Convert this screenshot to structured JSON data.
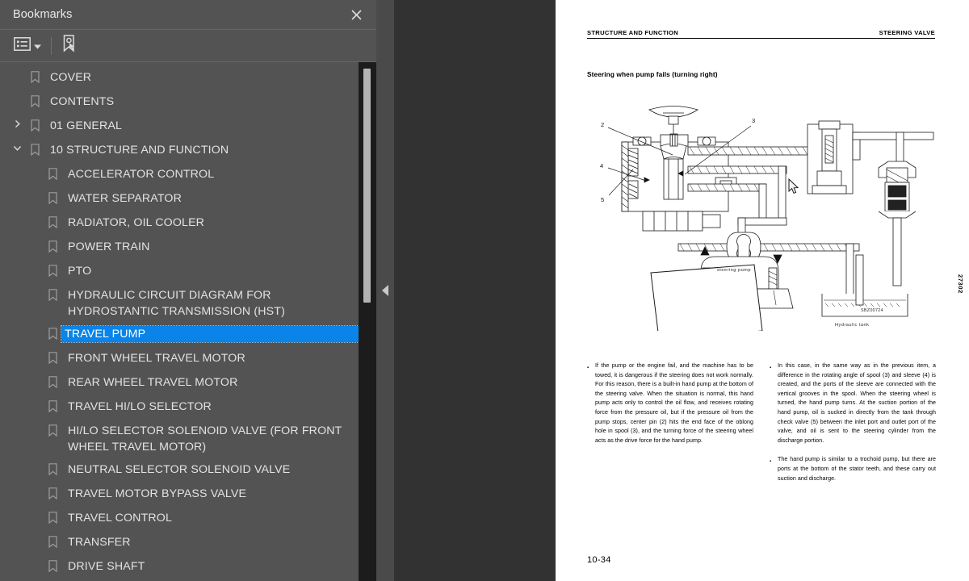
{
  "panel": {
    "title": "Bookmarks",
    "close_icon": "close-icon",
    "toolbar": {
      "options_icon": "list-options-icon",
      "chevron_icon": "chevron-down-icon",
      "new_bookmark_icon": "new-bookmark-icon"
    },
    "selected_color": "#0a84e8",
    "items": [
      {
        "label": "COVER",
        "level": 0,
        "twisty": "",
        "selected": false
      },
      {
        "label": "CONTENTS",
        "level": 0,
        "twisty": "",
        "selected": false
      },
      {
        "label": "01 GENERAL",
        "level": 0,
        "twisty": "collapsed",
        "selected": false
      },
      {
        "label": "10 STRUCTURE AND FUNCTION",
        "level": 0,
        "twisty": "expanded",
        "selected": false
      },
      {
        "label": "ACCELERATOR CONTROL",
        "level": 1,
        "twisty": "",
        "selected": false
      },
      {
        "label": "WATER SEPARATOR",
        "level": 1,
        "twisty": "",
        "selected": false
      },
      {
        "label": "RADIATOR, OIL COOLER",
        "level": 1,
        "twisty": "",
        "selected": false
      },
      {
        "label": "POWER TRAIN",
        "level": 1,
        "twisty": "",
        "selected": false
      },
      {
        "label": "PTO",
        "level": 1,
        "twisty": "",
        "selected": false
      },
      {
        "label": "HYDRAULIC CIRCUIT DIAGRAM FOR HYDROSTANTIC TRANSMISSION (HST)",
        "level": 1,
        "twisty": "",
        "selected": false
      },
      {
        "label": "TRAVEL PUMP",
        "level": 1,
        "twisty": "",
        "selected": true
      },
      {
        "label": "FRONT WHEEL TRAVEL MOTOR",
        "level": 1,
        "twisty": "",
        "selected": false
      },
      {
        "label": "REAR WHEEL TRAVEL MOTOR",
        "level": 1,
        "twisty": "",
        "selected": false
      },
      {
        "label": "TRAVEL HI/LO SELECTOR",
        "level": 1,
        "twisty": "",
        "selected": false
      },
      {
        "label": "HI/LO SELECTOR SOLENOID VALVE (FOR FRONT WHEEL TRAVEL MOTOR)",
        "level": 1,
        "twisty": "",
        "selected": false
      },
      {
        "label": "NEUTRAL SELECTOR SOLENOID VALVE",
        "level": 1,
        "twisty": "",
        "selected": false
      },
      {
        "label": "TRAVEL MOTOR BYPASS VALVE",
        "level": 1,
        "twisty": "",
        "selected": false
      },
      {
        "label": "TRAVEL CONTROL",
        "level": 1,
        "twisty": "",
        "selected": false
      },
      {
        "label": "TRANSFER",
        "level": 1,
        "twisty": "",
        "selected": false
      },
      {
        "label": "DRIVE SHAFT",
        "level": 1,
        "twisty": "",
        "selected": false
      }
    ]
  },
  "divider": {
    "collapse_icon": "collapse-left-arrow-icon"
  },
  "document": {
    "header_left": "STRUCTURE AND FUNCTION",
    "header_right": "STEERING VALVE",
    "subtitle": "Steering when pump fails (turning right)",
    "figure": {
      "code": "SBZ00724",
      "callouts": [
        "2",
        "3",
        "4",
        "5"
      ],
      "labels": [
        "steering pump",
        "Hydraulic tank"
      ]
    },
    "side_code": "27302",
    "page_number": "10-34",
    "columns": [
      {
        "bullets": [
          "If the pump or the engine fail, and the machine has to be towed, it is dangerous if the steering does not work normally. For this reason, there is a built-in hand pump at the bottom of the steering valve. When the situation is normal, this hand pump acts only to control the oil flow, and receives rotating force from the pressure oil, but if the pressure oil from the pump stops, center pin (2) hits the end face of the oblong hole in spool (3), and the turning force of the steering wheel acts as the drive force for the hand pump."
        ]
      },
      {
        "bullets": [
          "In this case, in the same way as in the previous item, a difference in the rotating angle of spool (3) and sleeve (4) is created, and the ports of the sleeve are connected with the vertical grooves in the spool. When the steering wheel is turned, the hand pump turns. At the suction portion of the hand pump, oil is sucked in directly from the tank through check valve (5) between the inlet port and outlet port of the valve, and oil is sent to the steering cylinder from the discharge portion.",
          "The hand pump is similar to a trochoid pump, but there are ports at the bottom of the stator teeth, and these carry out suction and discharge."
        ]
      }
    ]
  },
  "cursor": {
    "icon": "mouse-pointer-icon"
  }
}
